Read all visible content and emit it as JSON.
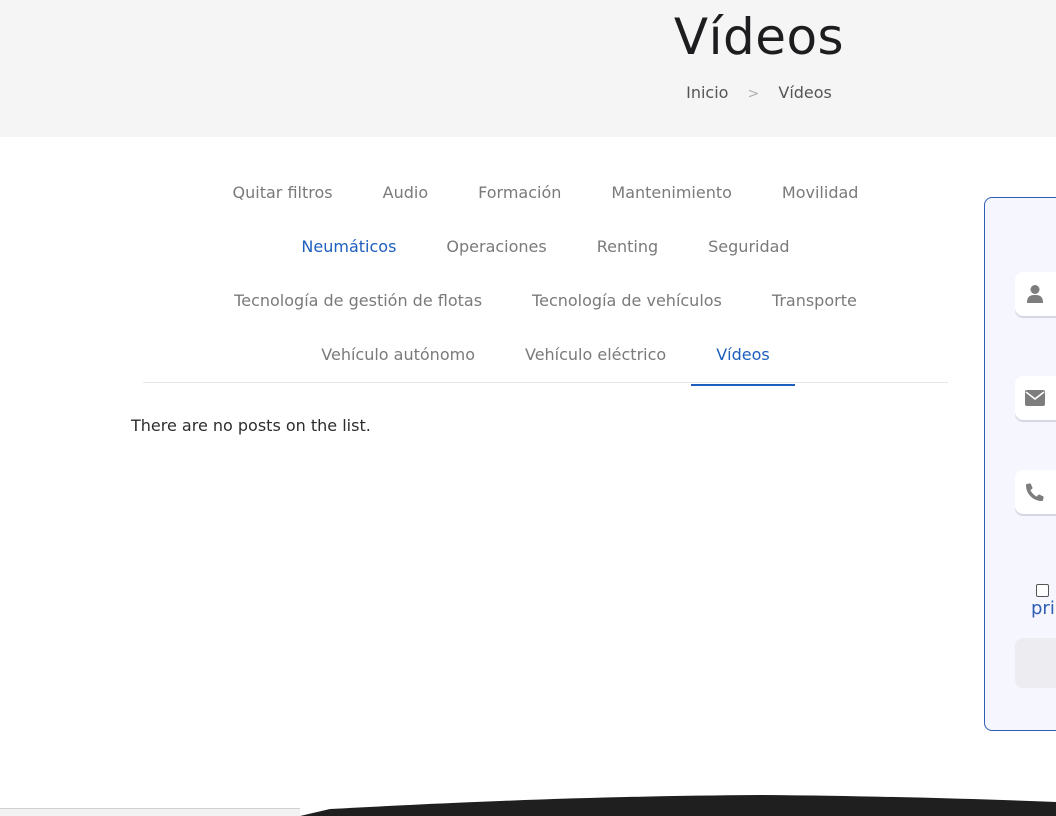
{
  "hero": {
    "title": "Vídeos",
    "breadcrumb": [
      {
        "label": "Inicio"
      },
      {
        "label": "Vídeos"
      }
    ],
    "separator": ">"
  },
  "filters": {
    "rows": [
      [
        {
          "label": "Quitar filtros"
        },
        {
          "label": "Audio"
        },
        {
          "label": "Formación"
        },
        {
          "label": "Mantenimiento"
        },
        {
          "label": "Movilidad"
        }
      ],
      [
        {
          "label": "Neumáticos"
        },
        {
          "label": "Operaciones"
        },
        {
          "label": "Renting"
        },
        {
          "label": "Seguridad"
        }
      ],
      [
        {
          "label": "Tecnología de gestión de flotas"
        },
        {
          "label": "Tecnología de vehículos"
        },
        {
          "label": "Transporte"
        }
      ],
      [
        {
          "label": "Vehículo autónomo"
        },
        {
          "label": "Vehículo eléctrico"
        },
        {
          "label": "Vídeos"
        }
      ]
    ],
    "active": "Vídeos",
    "highlighted": "Neumáticos"
  },
  "content": {
    "empty_message": "There are no posts on the list."
  },
  "side_form": {
    "icons": [
      "user-icon",
      "envelope-icon",
      "phone-icon"
    ],
    "privacy_text": "pri"
  },
  "colors": {
    "accent": "#1c5fbe",
    "hero_bg": "#f5f5f5",
    "panel_border": "#2f5fb3",
    "panel_bg": "#f6f6ff"
  }
}
